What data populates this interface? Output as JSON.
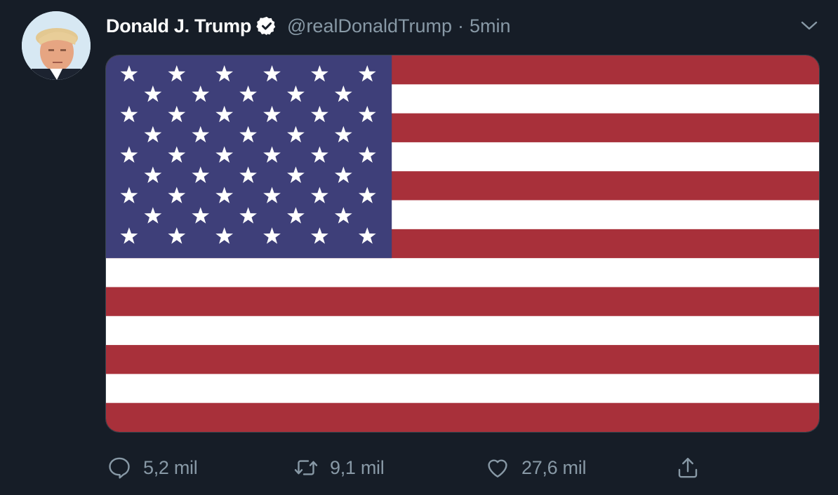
{
  "tweet": {
    "author_name": "Donald J. Trump",
    "handle": "@realDonaldTrump",
    "separator": "·",
    "time": "5min",
    "media": {
      "description_icon": "american-flag-image"
    },
    "actions": {
      "reply_count": "5,2 mil",
      "retweet_count": "9,1 mil",
      "like_count": "27,6 mil"
    }
  },
  "colors": {
    "background": "#161d27",
    "secondary_text": "#8899a6",
    "flag_red": "#a8303a",
    "flag_blue": "#3e3f79",
    "flag_white": "#ffffff"
  },
  "icons": {
    "verified": "verified-badge-icon",
    "more": "chevron-down-icon",
    "reply": "reply-icon",
    "retweet": "retweet-icon",
    "like": "heart-icon",
    "share": "share-icon"
  }
}
